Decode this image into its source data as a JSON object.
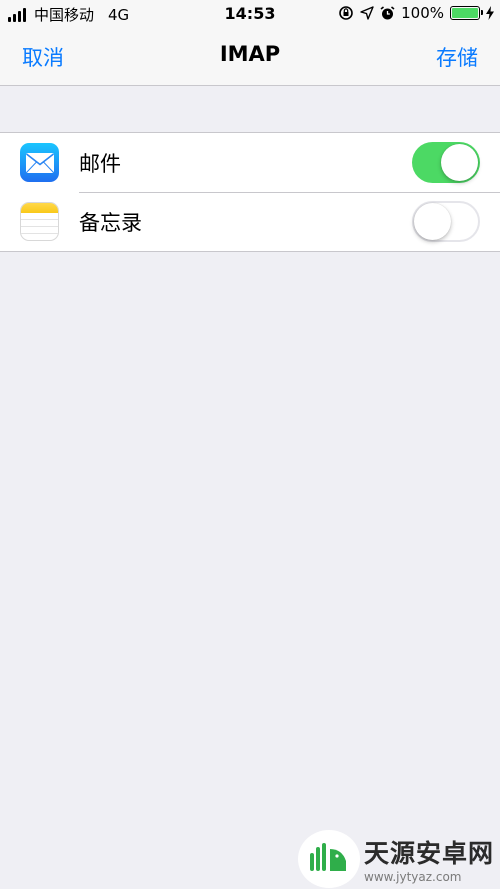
{
  "status_bar": {
    "carrier": "中国移动",
    "network": "4G",
    "time": "14:53",
    "battery_percent": "100%",
    "battery_level": 1.0
  },
  "nav": {
    "cancel_label": "取消",
    "title": "IMAP",
    "save_label": "存储"
  },
  "settings": {
    "items": [
      {
        "label": "邮件",
        "icon": "mail-icon",
        "enabled": true
      },
      {
        "label": "备忘录",
        "icon": "notes-icon",
        "enabled": false
      }
    ]
  },
  "watermark": {
    "name": "天源安卓网",
    "url": "www.jytyaz.com"
  },
  "colors": {
    "accent": "#0a7bff",
    "toggle_on": "#4cd964",
    "background": "#efeff4"
  }
}
